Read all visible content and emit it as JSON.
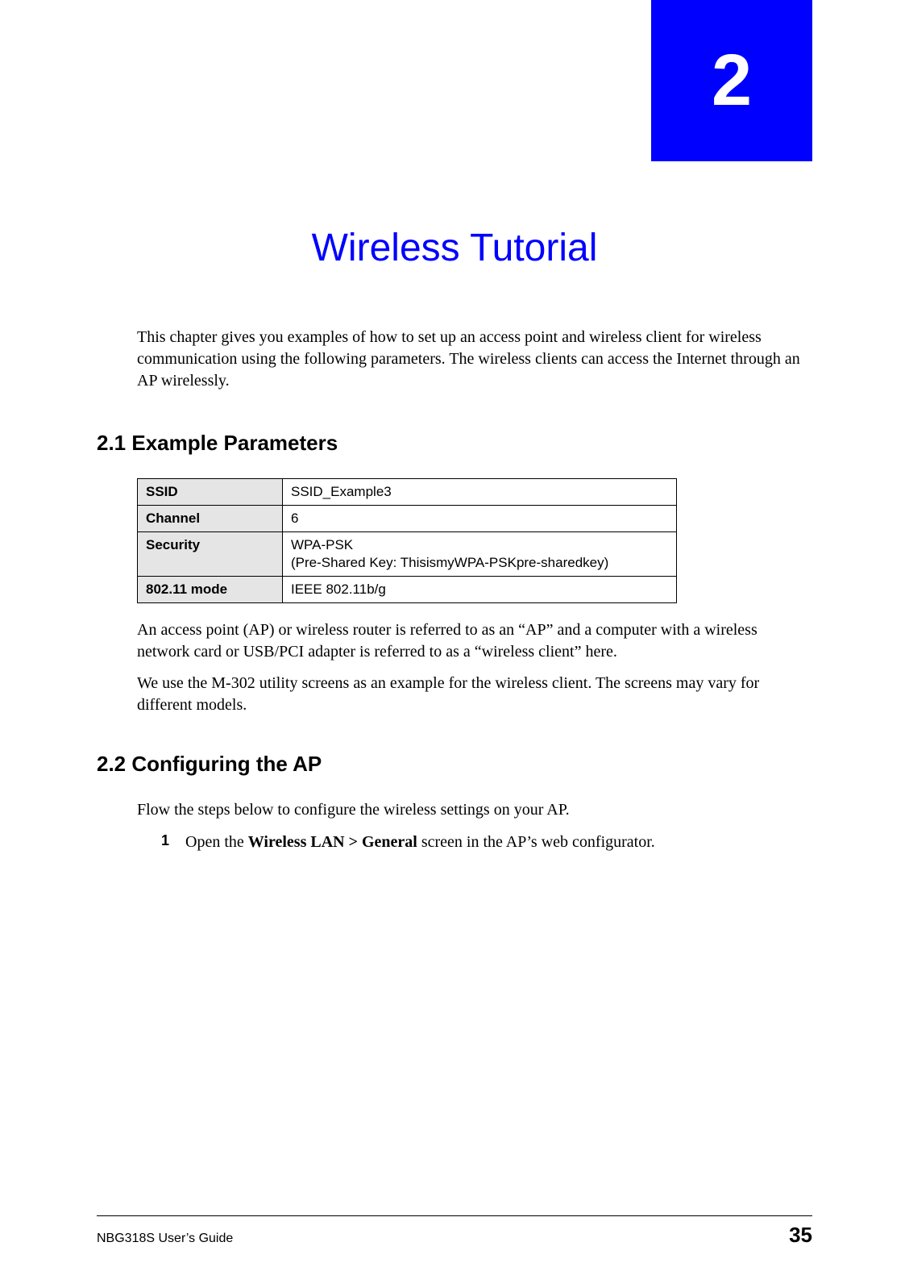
{
  "chapter": {
    "number": "2",
    "title": "Wireless Tutorial"
  },
  "intro": "This chapter gives you examples of how to set up an access point and wireless client for wireless communication using the following parameters. The wireless clients can access the Internet through an AP wirelessly.",
  "section_21": {
    "heading": "2.1  Example Parameters",
    "table": {
      "rows": [
        {
          "label": "SSID",
          "value": "SSID_Example3"
        },
        {
          "label": "Channel",
          "value": "6"
        },
        {
          "label": "Security",
          "value": "WPA-PSK\n(Pre-Shared Key: ThisismyWPA-PSKpre-sharedkey)"
        },
        {
          "label": "802.11 mode",
          "value": "IEEE 802.11b/g"
        }
      ]
    },
    "para1": "An access point (AP) or wireless router is referred to as an “AP” and a computer with a wireless network card or USB/PCI adapter is referred to as a “wireless client” here.",
    "para2": "We use the M-302 utility screens as an example for the wireless client. The screens may vary for different models."
  },
  "section_22": {
    "heading": "2.2  Configuring the AP",
    "intro": "Flow the steps below to configure the wireless settings on your AP.",
    "steps": [
      {
        "num": "1",
        "text_prefix": "Open the ",
        "text_bold": "Wireless LAN > General",
        "text_suffix": " screen in the AP’s web configurator."
      }
    ]
  },
  "footer": {
    "left": "NBG318S User’s Guide",
    "right": "35"
  }
}
